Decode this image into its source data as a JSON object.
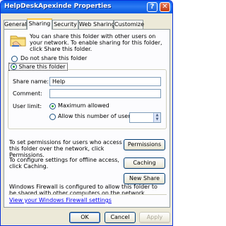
{
  "window": {
    "title": "HelpDeskApexinde Properties",
    "help_icon": "?",
    "close_icon": "✕"
  },
  "tabs": [
    {
      "label": "General"
    },
    {
      "label": "Sharing"
    },
    {
      "label": "Security"
    },
    {
      "label": "Web Sharing"
    },
    {
      "label": "Customize"
    }
  ],
  "sharing": {
    "intro_text": "You can share this folder with other users on your network. To enable sharing for this folder, click Share this folder.",
    "option_not_share": "Do not share this folder",
    "option_share": "Share this folder",
    "share_name_label": "Share name:",
    "share_name_value": "Help",
    "comment_label": "Comment:",
    "comment_value": "",
    "user_limit_label": "User limit:",
    "max_allowed_label": "Maximum allowed",
    "allow_users_label": "Allow this number of users:",
    "allow_users_value": "",
    "permissions_text": "To set permissions for users who access this folder over the network, click Permissions.",
    "permissions_button": "Permissions",
    "caching_text": "To configure settings for offline access, click Caching.",
    "caching_button": "Caching",
    "new_share_button": "New Share",
    "firewall_text": "Windows Firewall is configured to allow this folder to be shared with other computers on the network.",
    "firewall_link": "View your Windows Firewall settings"
  },
  "footer": {
    "ok": "OK",
    "cancel": "Cancel",
    "apply": "Apply"
  },
  "colors": {
    "titlebar": "#0a5be8",
    "tab_highlight": "#ffc83c",
    "link": "#0000ee",
    "radio_dot": "#21a121"
  }
}
